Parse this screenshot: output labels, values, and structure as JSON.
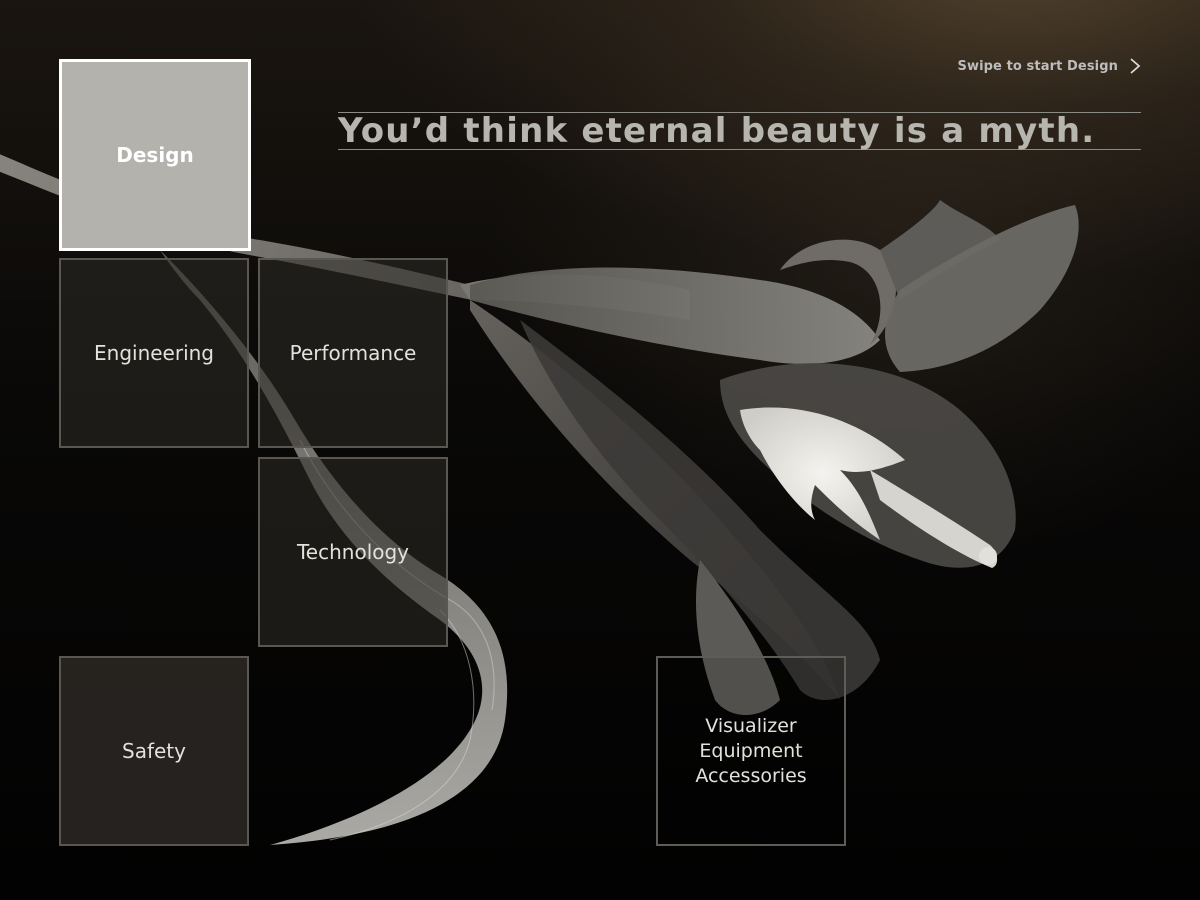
{
  "header": {
    "swipe_label": "Swipe to start Design",
    "swipe_icon": "chevron-right-icon"
  },
  "hero": {
    "headline": "You’d think eternal beauty is a myth."
  },
  "tiles": {
    "design": "Design",
    "engineering": "Engineering",
    "performance": "Performance",
    "technology": "Technology",
    "safety": "Safety",
    "visualizer_line1": "Visualizer",
    "visualizer_line2": "Equipment",
    "visualizer_line3": "Accessories"
  },
  "colors": {
    "active_tile": "#b3b2ac",
    "tile": "#2e2b27",
    "headline": "#b6b5ae"
  }
}
